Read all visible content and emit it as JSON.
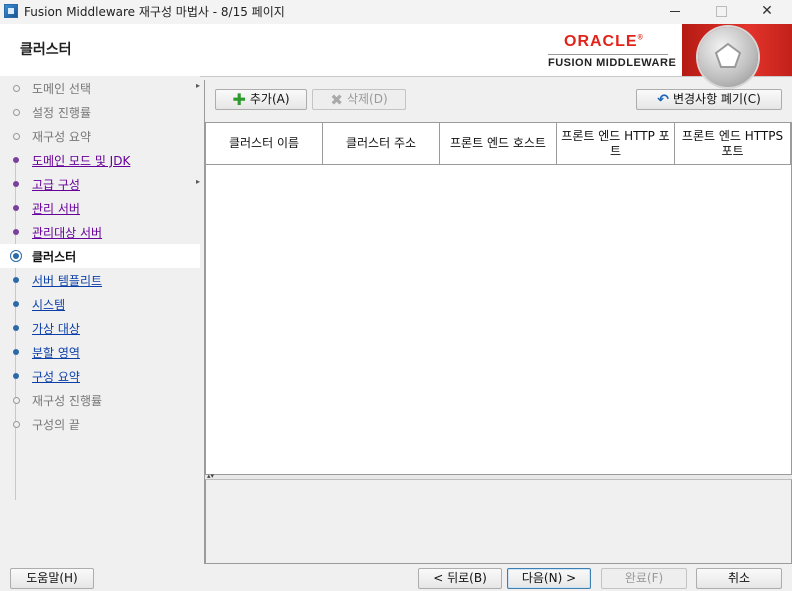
{
  "window": {
    "title": "Fusion Middleware 재구성 마법사 - 8/15 페이지",
    "minimize_symbol": "",
    "maximize_symbol": "",
    "close_symbol": "✕"
  },
  "header": {
    "page_title": "클러스터",
    "brand_name": "ORACLE",
    "brand_registered": "®",
    "product_name": "FUSION MIDDLEWARE",
    "brand_color": "#e2231a"
  },
  "nav": {
    "items": [
      {
        "label": "도메인 선택",
        "state": "gray"
      },
      {
        "label": "설정 진행률",
        "state": "gray"
      },
      {
        "label": "재구성 요약",
        "state": "gray"
      },
      {
        "label": "도메인 모드 및 JDK",
        "state": "visited"
      },
      {
        "label": "고급 구성",
        "state": "visited"
      },
      {
        "label": "관리 서버",
        "state": "visited"
      },
      {
        "label": "관리대상 서버",
        "state": "visited"
      },
      {
        "label": "클러스터",
        "state": "current"
      },
      {
        "label": "서버 템플리트",
        "state": "link"
      },
      {
        "label": "시스템",
        "state": "link"
      },
      {
        "label": "가상 대상",
        "state": "link"
      },
      {
        "label": "분할 영역",
        "state": "link"
      },
      {
        "label": "구성 요약",
        "state": "link"
      },
      {
        "label": "재구성 진행률",
        "state": "gray"
      },
      {
        "label": "구성의 끝",
        "state": "gray"
      }
    ]
  },
  "toolbar": {
    "add_label": "추가(A)",
    "add_icon": "plus-icon",
    "delete_label": "삭제(D)",
    "delete_icon": "x-icon",
    "discard_label": "변경사항 폐기(C)",
    "discard_icon": "undo-icon"
  },
  "table": {
    "columns": [
      "클러스터 이름",
      "클러스터 주소",
      "프론트 엔드 호스트",
      "프론트 엔드 HTTP 포트",
      "프론트 엔드 HTTPS 포트"
    ],
    "rows": []
  },
  "footer": {
    "help_label": "도움말(H)",
    "back_label": "< 뒤로(B)",
    "next_label": "다음(N) >",
    "finish_label": "완료(F)",
    "cancel_label": "취소"
  }
}
